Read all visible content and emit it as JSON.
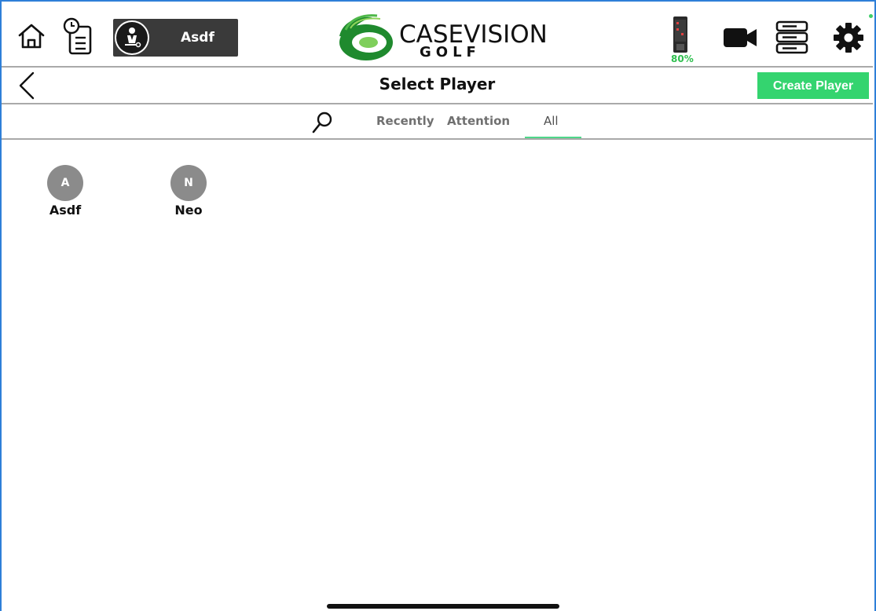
{
  "topbar": {
    "current_player": "Asdf",
    "logo": {
      "main": "CASEVISION",
      "sub": "GOLF"
    },
    "battery": "80%",
    "icons": [
      "home-icon",
      "history-icon",
      "device-icon",
      "camera-icon",
      "server-icon",
      "gear-icon"
    ],
    "colors": {
      "chip_bg": "#3a3a3a",
      "battery_text": "#2fbf4f",
      "status_dot": "#3fcf6a"
    }
  },
  "header": {
    "title": "Select Player",
    "create_label": "Create Player",
    "colors": {
      "create_bg": "#34d46f"
    }
  },
  "filters": {
    "tabs": [
      {
        "label": "Recently",
        "active": false
      },
      {
        "label": "Attention",
        "active": false
      },
      {
        "label": "All",
        "active": true
      }
    ],
    "active_color": "#4fd68a"
  },
  "players": [
    {
      "initial": "A",
      "name": "Asdf"
    },
    {
      "initial": "N",
      "name": "Neo"
    }
  ]
}
